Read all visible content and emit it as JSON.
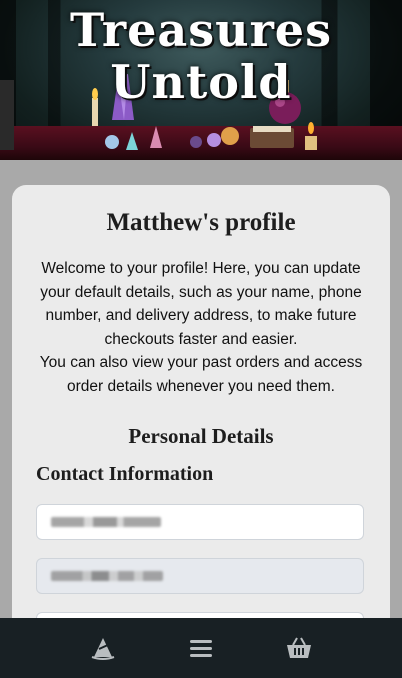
{
  "header": {
    "brand": "Treasures Untold",
    "brand_line1": "Treasures",
    "brand_line2": "Untold"
  },
  "profile": {
    "title": "Matthew's profile",
    "intro_1": "Welcome to your profile! Here, you can update your default details, such as your name, phone number, and delivery address, to make future checkouts faster and easier.",
    "intro_2": "You can also view your past orders and access order details whenever you need them.",
    "personal_heading": "Personal Details",
    "contact_heading": "Contact Information"
  },
  "fields": {
    "name_value": "",
    "email_value": "",
    "phone_value": ""
  },
  "nav": {
    "items": [
      "wizard-hat-icon",
      "menu-icon",
      "basket-icon"
    ]
  },
  "colors": {
    "nav_bg": "#182024",
    "card_bg": "#ebebeb",
    "page_bg": "#a9a9a9",
    "banner_red": "#5a1020"
  }
}
